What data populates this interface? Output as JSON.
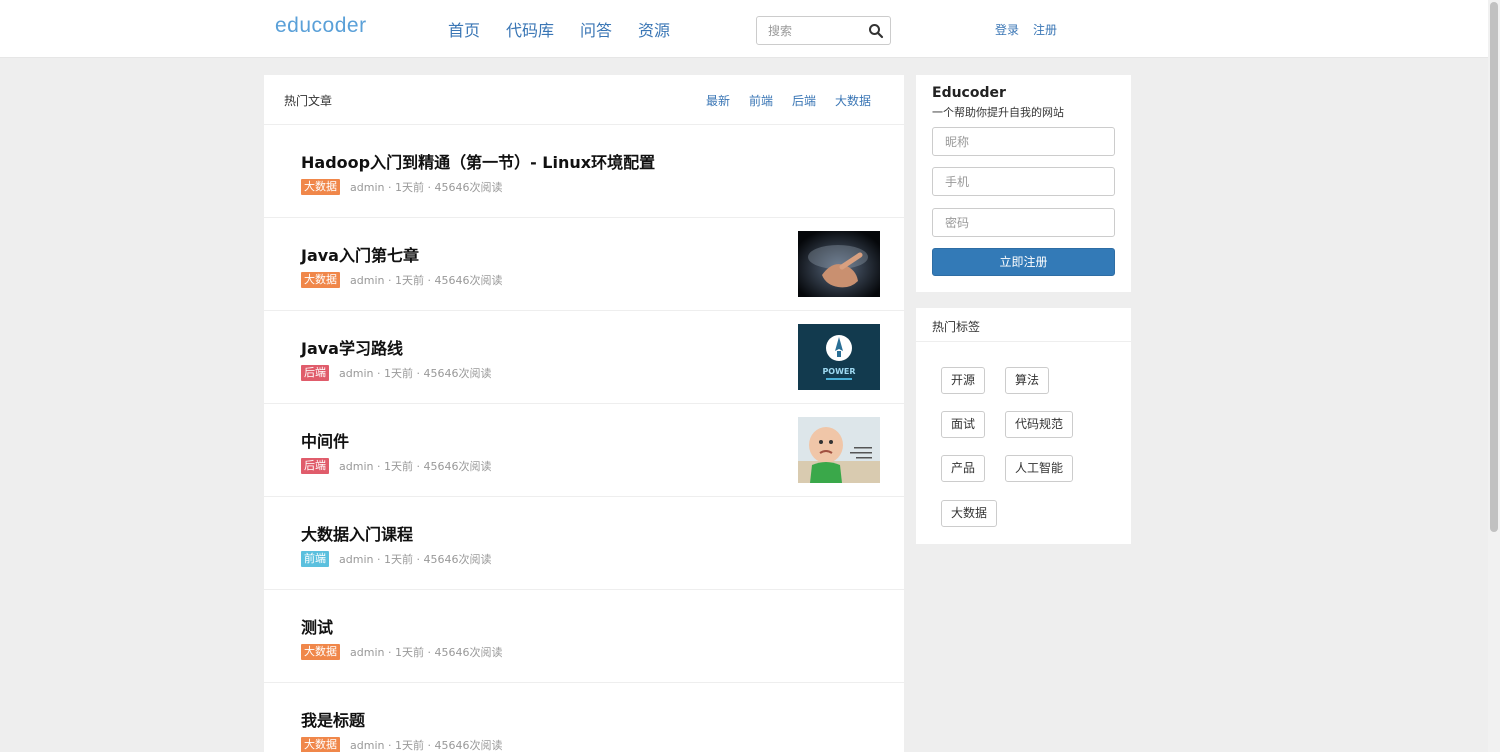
{
  "header": {
    "logo": "educoder",
    "nav": [
      "首页",
      "代码库",
      "问答",
      "资源"
    ],
    "search_placeholder": "搜索",
    "login": "登录",
    "register": "注册"
  },
  "main": {
    "section_title": "热门文章",
    "filters": [
      "最新",
      "前端",
      "后端",
      "大数据"
    ],
    "articles": [
      {
        "title": "Hadoop入门到精通（第一节）- Linux环境配置",
        "tag": "大数据",
        "tag_color": "#f0874a",
        "author": "admin",
        "time": "1天前",
        "reads": "45646次阅读",
        "thumbnail": null
      },
      {
        "title": "Java入门第七章",
        "tag": "大数据",
        "tag_color": "#f0874a",
        "author": "admin",
        "time": "1天前",
        "reads": "45646次阅读",
        "thumbnail": "hand-world-map-image"
      },
      {
        "title": "Java学习路线",
        "tag": "后端",
        "tag_color": "#e05c6b",
        "author": "admin",
        "time": "1天前",
        "reads": "45646次阅读",
        "thumbnail": "power-rocket-image"
      },
      {
        "title": "中间件",
        "tag": "后端",
        "tag_color": "#e05c6b",
        "author": "admin",
        "time": "1天前",
        "reads": "45646次阅读",
        "thumbnail": "success-kid-image"
      },
      {
        "title": "大数据入门课程",
        "tag": "前端",
        "tag_color": "#5bc0de",
        "author": "admin",
        "time": "1天前",
        "reads": "45646次阅读",
        "thumbnail": null
      },
      {
        "title": "测试",
        "tag": "大数据",
        "tag_color": "#f0874a",
        "author": "admin",
        "time": "1天前",
        "reads": "45646次阅读",
        "thumbnail": null
      },
      {
        "title": "我是标题",
        "tag": "大数据",
        "tag_color": "#f0874a",
        "author": "admin",
        "time": "1天前",
        "reads": "45646次阅读",
        "thumbnail": null
      }
    ]
  },
  "sidebar": {
    "register": {
      "brand": "Educoder",
      "slogan": "一个帮助你提升自我的网站",
      "nickname_placeholder": "昵称",
      "phone_placeholder": "手机",
      "password_placeholder": "密码",
      "submit": "立即注册"
    },
    "tags": {
      "title": "热门标签",
      "items": [
        "开源",
        "算法",
        "面试",
        "代码规范",
        "产品",
        "人工智能",
        "大数据"
      ]
    }
  }
}
